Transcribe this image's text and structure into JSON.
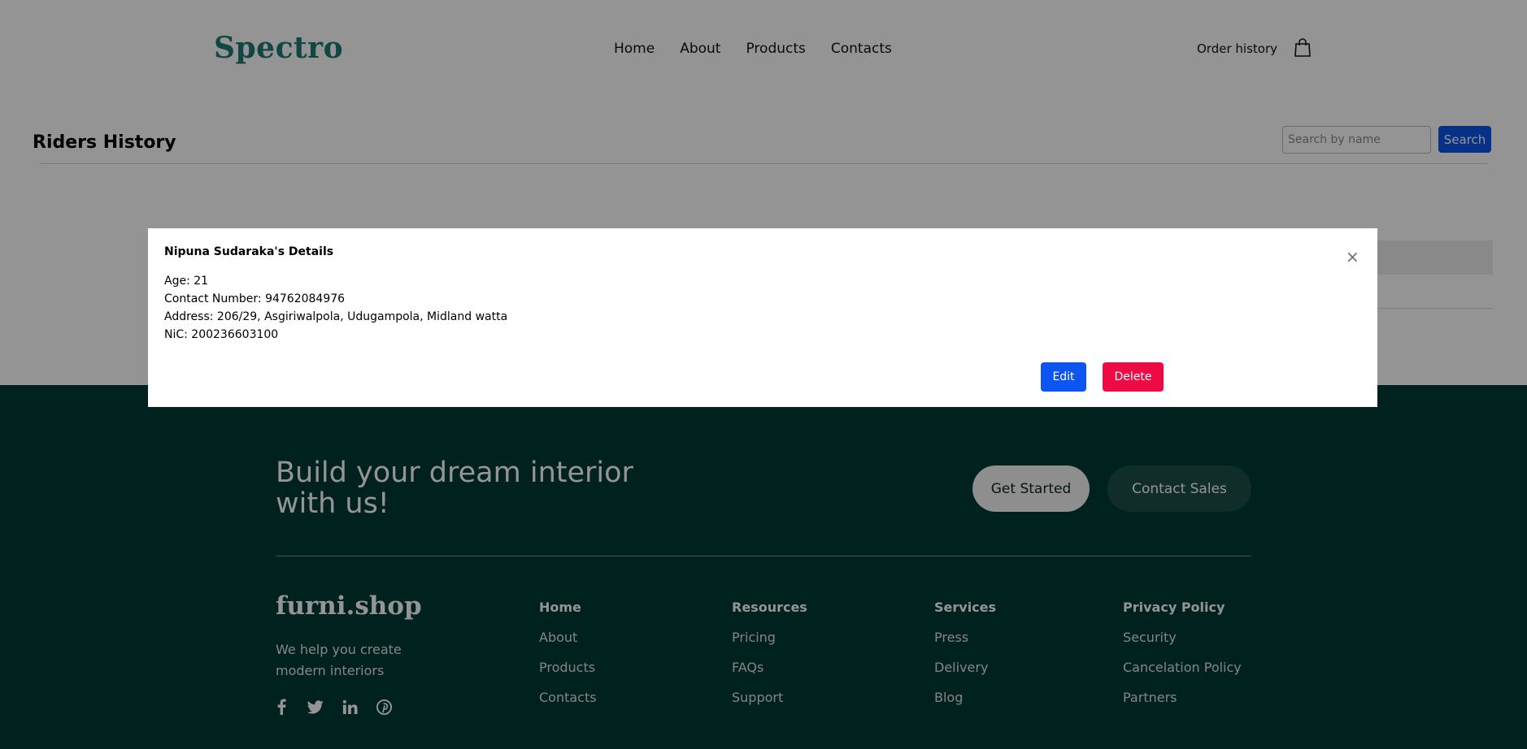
{
  "header": {
    "logo": "Spectro",
    "nav": [
      "Home",
      "About",
      "Products",
      "Contacts"
    ],
    "order_history": "Order history",
    "cart_icon": "shopping-bag-icon"
  },
  "riders": {
    "title": "Riders History",
    "search_placeholder": "Search by name",
    "search_button": "Search"
  },
  "modal": {
    "title": "Nipuna Sudaraka's Details",
    "close": "×",
    "age": "Age: 21",
    "contact": "Contact Number: 94762084976",
    "address": "Address: 206/29, Asgiriwalpola, Udugampola, Midland watta",
    "nic": "NiC: 200236603100",
    "edit_button": "Edit",
    "delete_button": "Delete"
  },
  "footer": {
    "cta": "Build your dream interior with us!",
    "get_started": "Get Started",
    "contact_sales": "Contact Sales",
    "brand": "furni.shop",
    "tagline": "We help you create modern interiors",
    "socials": [
      "facebook-icon",
      "twitter-icon",
      "linkedin-icon",
      "pinterest-icon"
    ],
    "columns": [
      {
        "title": "Home",
        "links": [
          "About",
          "Products",
          "Contacts"
        ]
      },
      {
        "title": "Resources",
        "links": [
          "Pricing",
          "FAQs",
          "Support"
        ]
      },
      {
        "title": "Services",
        "links": [
          "Press",
          "Delivery",
          "Blog"
        ]
      },
      {
        "title": "Privacy Policy",
        "links": [
          "Security",
          "Cancelation Policy",
          "Partners"
        ]
      }
    ]
  },
  "colors": {
    "brand_teal": "#1c7a72",
    "footer_bg": "#003b35",
    "primary_button": "#0d55f0",
    "danger_button": "#ee0a45"
  }
}
